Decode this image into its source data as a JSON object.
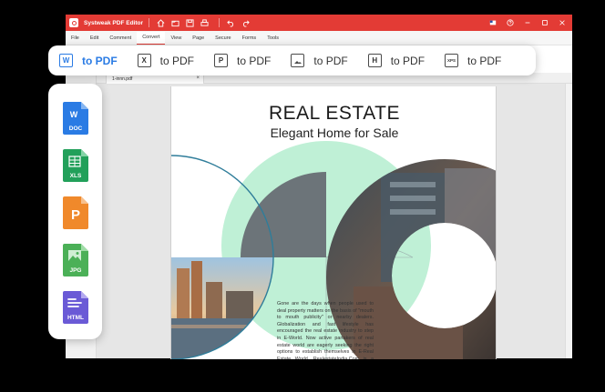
{
  "app": {
    "title": "Systweak PDF Editor"
  },
  "menu": [
    "File",
    "Edit",
    "Comment",
    "Convert",
    "View",
    "Page",
    "Secure",
    "Forms",
    "Tools"
  ],
  "active_menu": "Convert",
  "document_tab": {
    "name": "1-innn.pdf"
  },
  "convert_bar": {
    "items": [
      {
        "icon_text": "W",
        "label": "to PDF",
        "icon": "word-icon",
        "highlight": true
      },
      {
        "icon_text": "X",
        "label": "to PDF",
        "icon": "excel-icon",
        "highlight": false
      },
      {
        "icon_text": "P",
        "label": "to PDF",
        "icon": "powerpoint-icon",
        "highlight": false
      },
      {
        "icon_text": "",
        "label": "to PDF",
        "icon": "image-icon",
        "highlight": false
      },
      {
        "icon_text": "H",
        "label": "to PDF",
        "icon": "html-icon",
        "highlight": false
      },
      {
        "icon_text": "XPS",
        "label": "to PDF",
        "icon": "xps-icon",
        "highlight": false
      }
    ]
  },
  "formats": [
    {
      "label": "DOC",
      "color": "#2a7be4",
      "glyph": "W"
    },
    {
      "label": "XLS",
      "color": "#22a05a",
      "glyph": "X"
    },
    {
      "label": "",
      "color": "#f0892b",
      "glyph": "P"
    },
    {
      "label": "JPG",
      "color": "#4bb057",
      "glyph": "img"
    },
    {
      "label": "HTML",
      "color": "#6a5ad6",
      "glyph": "lines"
    }
  ],
  "page": {
    "title": "REAL ESTATE",
    "subtitle": "Elegant Home for Sale",
    "body": "Gone are the days when people used to deal property matters on the basis of \"mouth to mouth publicity\" or nearby dealers. Globalization and fast lifestyle has encouraged the real estate industry to step in E-World. Now active partakers of real estate world are eagerly seeking the right options to establish themselves in E-Real Estate World. RealestateIndia.Com is a solution to all"
  },
  "colors": {
    "brand": "#e33b35",
    "accent": "#2a7be4",
    "mint": "#bff0d6"
  }
}
